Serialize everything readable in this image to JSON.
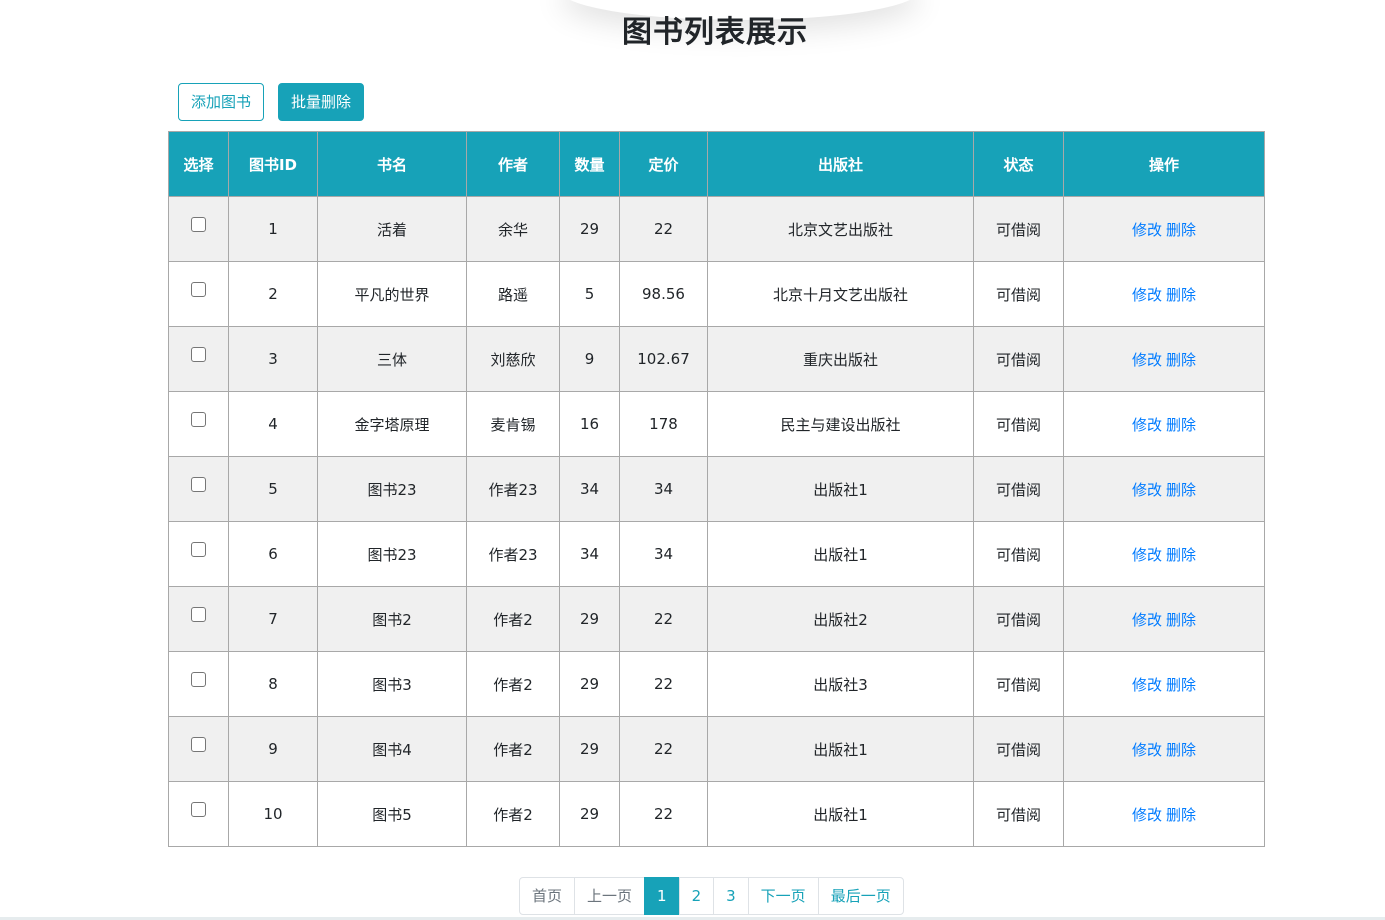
{
  "page": {
    "title": "图书列表展示"
  },
  "toolbar": {
    "add_label": "添加图书",
    "batch_delete_label": "批量删除"
  },
  "table": {
    "headers": [
      "选择",
      "图书ID",
      "书名",
      "作者",
      "数量",
      "定价",
      "出版社",
      "状态",
      "操作"
    ],
    "rows": [
      {
        "id": "1",
        "name": "活着",
        "author": "余华",
        "count": "29",
        "price": "22",
        "publisher": "北京文艺出版社",
        "status": "可借阅",
        "edit": "修改",
        "delete": "删除"
      },
      {
        "id": "2",
        "name": "平凡的世界",
        "author": "路遥",
        "count": "5",
        "price": "98.56",
        "publisher": "北京十月文艺出版社",
        "status": "可借阅",
        "edit": "修改",
        "delete": "删除"
      },
      {
        "id": "3",
        "name": "三体",
        "author": "刘慈欣",
        "count": "9",
        "price": "102.67",
        "publisher": "重庆出版社",
        "status": "可借阅",
        "edit": "修改",
        "delete": "删除"
      },
      {
        "id": "4",
        "name": "金字塔原理",
        "author": "麦肯锡",
        "count": "16",
        "price": "178",
        "publisher": "民主与建设出版社",
        "status": "可借阅",
        "edit": "修改",
        "delete": "删除"
      },
      {
        "id": "5",
        "name": "图书23",
        "author": "作者23",
        "count": "34",
        "price": "34",
        "publisher": "出版社1",
        "status": "可借阅",
        "edit": "修改",
        "delete": "删除"
      },
      {
        "id": "6",
        "name": "图书23",
        "author": "作者23",
        "count": "34",
        "price": "34",
        "publisher": "出版社1",
        "status": "可借阅",
        "edit": "修改",
        "delete": "删除"
      },
      {
        "id": "7",
        "name": "图书2",
        "author": "作者2",
        "count": "29",
        "price": "22",
        "publisher": "出版社2",
        "status": "可借阅",
        "edit": "修改",
        "delete": "删除"
      },
      {
        "id": "8",
        "name": "图书3",
        "author": "作者2",
        "count": "29",
        "price": "22",
        "publisher": "出版社3",
        "status": "可借阅",
        "edit": "修改",
        "delete": "删除"
      },
      {
        "id": "9",
        "name": "图书4",
        "author": "作者2",
        "count": "29",
        "price": "22",
        "publisher": "出版社1",
        "status": "可借阅",
        "edit": "修改",
        "delete": "删除"
      },
      {
        "id": "10",
        "name": "图书5",
        "author": "作者2",
        "count": "29",
        "price": "22",
        "publisher": "出版社1",
        "status": "可借阅",
        "edit": "修改",
        "delete": "删除"
      }
    ]
  },
  "pagination": {
    "first": "首页",
    "prev": "上一页",
    "pages": [
      "1",
      "2",
      "3"
    ],
    "current": "1",
    "next": "下一页",
    "last": "最后一页"
  },
  "colors": {
    "accent": "#17a2b8",
    "link": "#007bff",
    "row_stripe": "#f0f0f0"
  }
}
